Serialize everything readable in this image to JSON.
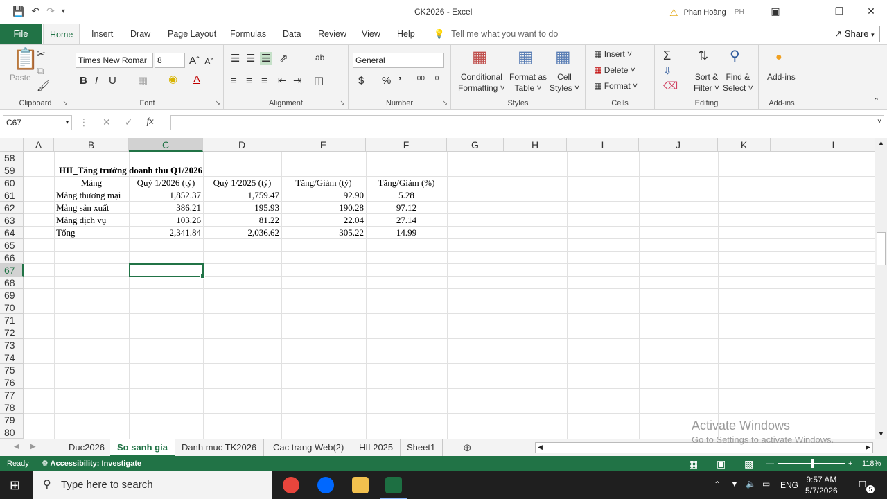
{
  "window": {
    "title": "CK2026  -  Excel",
    "user_name": "Phan Hoàng",
    "user_initials": "PH"
  },
  "ribbon_tabs": [
    "File",
    "Home",
    "Insert",
    "Draw",
    "Page Layout",
    "Formulas",
    "Data",
    "Review",
    "View",
    "Help"
  ],
  "tell_me": "Tell me what you want to do",
  "share_label": "Share",
  "ribbon": {
    "clipboard": {
      "paste": "Paste",
      "group": "Clipboard"
    },
    "font": {
      "name": "Times New Romar",
      "size": "8",
      "group": "Font"
    },
    "alignment": {
      "group": "Alignment"
    },
    "number": {
      "format": "General",
      "group": "Number"
    },
    "styles": {
      "conditional": "Conditional",
      "conditional2": "Formatting",
      "format_as": "Format as",
      "format_as2": "Table",
      "cell": "Cell",
      "cell2": "Styles",
      "group": "Styles"
    },
    "cells": {
      "insert": "Insert",
      "delete": "Delete",
      "format": "Format",
      "group": "Cells"
    },
    "editing": {
      "sort": "Sort &",
      "sort2": "Filter",
      "find": "Find &",
      "find2": "Select",
      "group": "Editing"
    },
    "addins": {
      "label": "Add-ins",
      "group": "Add-ins"
    }
  },
  "formula_bar": {
    "name_box": "C67",
    "formula": ""
  },
  "columns": [
    "A",
    "B",
    "C",
    "D",
    "E",
    "F",
    "G",
    "H",
    "I",
    "J",
    "K",
    "L"
  ],
  "rows": [
    "58",
    "59",
    "60",
    "61",
    "62",
    "63",
    "64",
    "65",
    "66",
    "67",
    "68",
    "69",
    "70",
    "71",
    "72",
    "73",
    "74",
    "75",
    "76",
    "77",
    "78",
    "79",
    "80"
  ],
  "sheet": {
    "title": "HII_Tăng trưởng doanh thu Q1/2026",
    "headers": [
      "Mảng",
      "Quý 1/2026 (tỷ)",
      "Quý 1/2025 (tỷ)",
      "Tăng/Giảm (tỷ)",
      "Tăng/Giảm (%)"
    ],
    "rows": [
      [
        "Mảng thương mại",
        "1,852.37",
        "1,759.47",
        "92.90",
        "5.28"
      ],
      [
        "Mảng sản xuất",
        "386.21",
        "195.93",
        "190.28",
        "97.12"
      ],
      [
        "Mảng dịch vụ",
        "103.26",
        "81.22",
        "22.04",
        "27.14"
      ],
      [
        "Tổng",
        "2,341.84",
        "2,036.62",
        "305.22",
        "14.99"
      ]
    ]
  },
  "sheet_tabs": [
    "Duc2026",
    "So sanh gia",
    "Danh muc TK2026",
    "Cac trang Web(2)",
    "HII 2025",
    "Sheet1"
  ],
  "active_sheet": "So sanh gia",
  "status": {
    "ready": "Ready",
    "accessibility": "Accessibility: Investigate",
    "zoom": "118%"
  },
  "watermark": {
    "line1": "Activate Windows",
    "line2": "Go to Settings to activate Windows."
  },
  "taskbar": {
    "search_placeholder": "Type here to search",
    "lang": "ENG",
    "time": "9:57 AM",
    "date": "5/7/2026",
    "notifications": "5"
  }
}
